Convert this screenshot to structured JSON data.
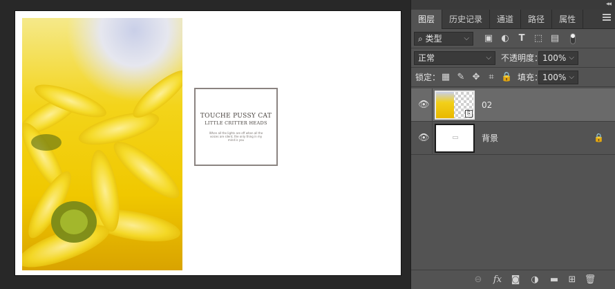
{
  "panel": {
    "collapse_glyph": "◂◂",
    "tabs": [
      {
        "label": "图层",
        "active": true
      },
      {
        "label": "历史记录",
        "active": false
      },
      {
        "label": "通道",
        "active": false
      },
      {
        "label": "路径",
        "active": false
      },
      {
        "label": "属性",
        "active": false
      }
    ],
    "filter": {
      "label": "类型",
      "search_glyph": "⌕"
    },
    "blend_mode": "正常",
    "opacity_label": "不透明度：",
    "opacity_value": "100%",
    "lock_label": "锁定：",
    "fill_label": "填充：",
    "fill_value": "100%"
  },
  "layers": [
    {
      "name": "02",
      "selected": true,
      "smart_object": true
    },
    {
      "name": "背景",
      "selected": false,
      "locked": true
    }
  ],
  "canvas": {
    "card_title": "TOUCHE PUSSY CAT",
    "card_subtitle": "LITTLE CRITTER HEADS",
    "card_body": "When all the lights are off when all the voices are silent, the only thing in my mind is you"
  },
  "icons": {
    "eye": "👁",
    "lock": "🔒",
    "fx": "fx",
    "link": "⊖",
    "mask": "◙",
    "adjust": "◑",
    "folder": "▬",
    "new": "⊞",
    "trash": "🗑"
  },
  "colors": {
    "panel_bg": "#535353",
    "selected_layer": "#6a6a6a",
    "workspace_bg": "#282828"
  }
}
